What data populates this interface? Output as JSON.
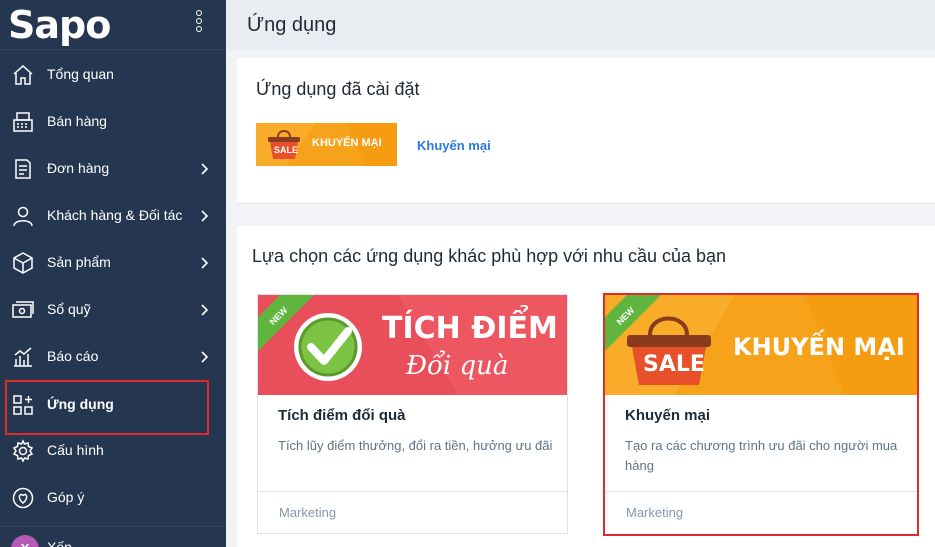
{
  "brand": {
    "logo": "Sapo"
  },
  "sidebar": {
    "items": [
      {
        "label": "Tổng quan",
        "icon": "home-icon",
        "chevron": false
      },
      {
        "label": "Bán hàng",
        "icon": "cash-register-icon",
        "chevron": false
      },
      {
        "label": "Đơn hàng",
        "icon": "order-icon",
        "chevron": true
      },
      {
        "label": "Khách hàng & Đối tác",
        "icon": "user-icon",
        "chevron": true
      },
      {
        "label": "Sản phẩm",
        "icon": "box-icon",
        "chevron": true
      },
      {
        "label": "Sổ quỹ",
        "icon": "money-icon",
        "chevron": true
      },
      {
        "label": "Báo cáo",
        "icon": "report-icon",
        "chevron": true
      },
      {
        "label": "Ứng dụng",
        "icon": "apps-icon",
        "chevron": false,
        "active": true
      },
      {
        "label": "Cấu hình",
        "icon": "gear-icon",
        "chevron": false
      },
      {
        "label": "Góp ý",
        "icon": "feedback-icon",
        "chevron": false
      }
    ],
    "user": {
      "initial": "X",
      "name": "Xến"
    }
  },
  "header": {
    "title": "Ứng dụng"
  },
  "installed": {
    "title": "Ứng dụng đã cài đặt",
    "banner_sale": "SALE",
    "banner_text": "KHUYẾN MẠI",
    "link": "Khuyến mại"
  },
  "suggest": {
    "title": "Lựa chọn các ứng dụng khác phù hợp với nhu cầu của bạn",
    "apps": [
      {
        "name": "Tích điểm đổi quà",
        "desc": "Tích lũy điểm thưởng, đổi ra tiền, hưởng ưu đãi",
        "category": "Marketing",
        "badge": "NEW",
        "banner_line1": "TÍCH ĐIỂM",
        "banner_line2": "Đổi quà"
      },
      {
        "name": "Khuyến mại",
        "desc": "Tạo ra các chương trình ưu đãi cho người mua hàng",
        "category": "Marketing",
        "badge": "NEW",
        "banner_sale": "SALE",
        "banner_text": "KHUYẾN MẠI"
      }
    ]
  },
  "colors": {
    "sidebar": "#253750",
    "accent_red": "#e02b2b",
    "link_blue": "#2a7ae2",
    "promo_orange": "#f7a21b",
    "points_red": "#e94f5a",
    "badge_green": "#5fb53d"
  }
}
